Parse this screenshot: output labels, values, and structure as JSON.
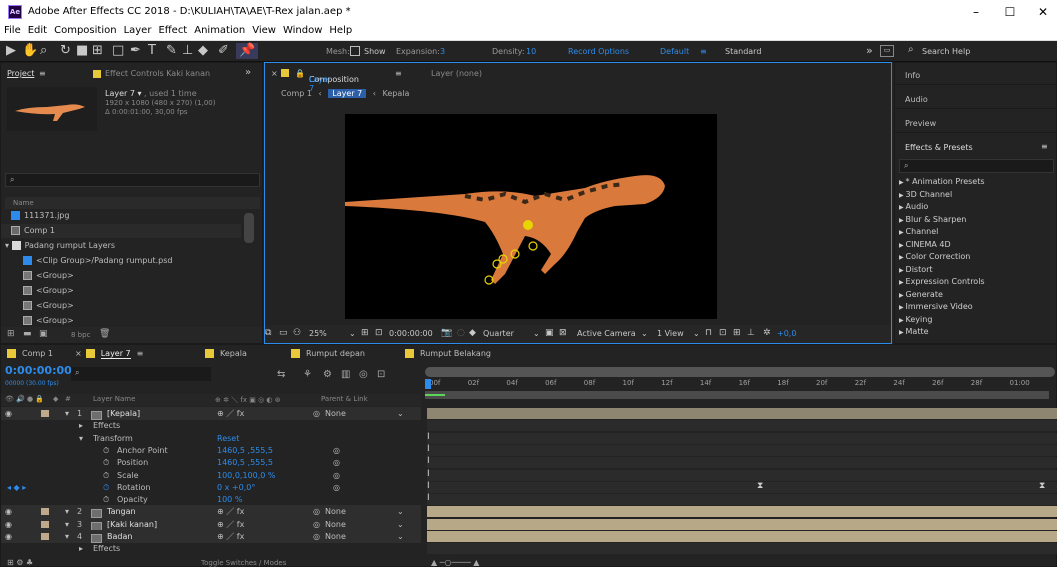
{
  "window": {
    "title": "Adobe After Effects CC 2018 - D:\\KULIAH\\TA\\AE\\T-Rex jalan.aep *",
    "app_badge": "Ae",
    "minimize": "–",
    "maximize": "☐",
    "close": "✕"
  },
  "menu": [
    "File",
    "Edit",
    "Composition",
    "Layer",
    "Effect",
    "Animation",
    "View",
    "Window",
    "Help"
  ],
  "toolbar": {
    "mesh_label": "Mesh:",
    "show_label": "Show",
    "expansion_label": "Expansion:",
    "expansion_value": "3",
    "density_label": "Density:",
    "density_value": "10",
    "record_options": "Record Options",
    "workspace_default": "Default",
    "workspace_menu": "≡",
    "workspace_standard": "Standard",
    "more": "»",
    "search_placeholder": "Search Help"
  },
  "project": {
    "tab": "Project",
    "tab_menu": "≡",
    "effect_controls": "Effect Controls Kaki kanan",
    "more": "»",
    "layer_name": "Layer 7",
    "used": ", used 1 time",
    "res": "1920 x 1080  (480 x 270) (1,00)",
    "dur": "Δ 0:00:01:00, 30,00 fps",
    "search_icon": "⌕",
    "col_name": "Name",
    "items": [
      {
        "label": "111371.jpg",
        "type": "jpg"
      },
      {
        "label": "Comp 1",
        "type": "comp"
      },
      {
        "label": "Padang rumput Layers",
        "type": "folder"
      },
      {
        "label": "<Clip Group>/Padang rumput.psd",
        "type": "psd"
      },
      {
        "label": "<Group>",
        "type": "grp"
      },
      {
        "label": "<Group>",
        "type": "grp"
      },
      {
        "label": "<Group>",
        "type": "grp"
      },
      {
        "label": "<Group>",
        "type": "grp"
      }
    ],
    "bpc": "8 bpc"
  },
  "comp": {
    "tab": "Composition",
    "tab_comp": "Layer 7",
    "tab_menu": "≡",
    "layer_none": "Layer (none)",
    "breadcrumb": [
      "Comp 1",
      "Layer 7",
      "Kepala"
    ],
    "zoom": "25%",
    "timecode": "0:00:00:00",
    "resolution": "Quarter",
    "camera": "Active Camera",
    "views": "1 View",
    "exposure": "+0,0"
  },
  "right": {
    "info": "Info",
    "audio": "Audio",
    "preview": "Preview",
    "effects": "Effects & Presets",
    "effects_menu": "≡",
    "items": [
      "* Animation Presets",
      "3D Channel",
      "Audio",
      "Blur & Sharpen",
      "Channel",
      "CINEMA 4D",
      "Color Correction",
      "Distort",
      "Expression Controls",
      "Generate",
      "Immersive Video",
      "Keying",
      "Matte"
    ]
  },
  "timeline": {
    "tabs": [
      {
        "label": "Comp 1",
        "color": "#e8c93a"
      },
      {
        "label": "Layer 7",
        "color": "#e8c93a"
      },
      {
        "label": "Kepala",
        "color": "#e8c93a"
      },
      {
        "label": "Rumput depan",
        "color": "#e8c93a"
      },
      {
        "label": "Rumput Belakang",
        "color": "#e8c93a"
      }
    ],
    "tab_menu": "≡",
    "tab_close": "×",
    "timecode": "0:00:00:00",
    "fps": "00000 (30.00 fps)",
    "col_layer": "Layer Name",
    "col_parent": "Parent & Link",
    "num_label": "#",
    "toggle": "Toggle Switches / Modes",
    "ticks": [
      "00f",
      "02f",
      "04f",
      "06f",
      "08f",
      "10f",
      "12f",
      "14f",
      "16f",
      "18f",
      "20f",
      "22f",
      "24f",
      "26f",
      "28f",
      "01:00"
    ],
    "layers": [
      {
        "num": "1",
        "name": "[Kepala]",
        "parent": "None",
        "kind": "layer"
      },
      {
        "name": "Effects",
        "kind": "group"
      },
      {
        "name": "Transform",
        "kind": "group",
        "value": "Reset"
      },
      {
        "name": "Anchor Point",
        "kind": "prop",
        "value": "1460,5 ,555,5"
      },
      {
        "name": "Position",
        "kind": "prop",
        "value": "1460,5 ,555,5"
      },
      {
        "name": "Scale",
        "kind": "prop",
        "value": "100,0,100,0 %"
      },
      {
        "name": "Rotation",
        "kind": "prop",
        "value": "0 x +0,0°"
      },
      {
        "name": "Opacity",
        "kind": "prop",
        "value": "100 %"
      },
      {
        "num": "2",
        "name": "Tangan",
        "parent": "None",
        "kind": "layer"
      },
      {
        "num": "3",
        "name": "[Kaki kanan]",
        "parent": "None",
        "kind": "layer"
      },
      {
        "num": "4",
        "name": "Badan",
        "parent": "None",
        "kind": "layer"
      },
      {
        "name": "Effects",
        "kind": "group"
      }
    ]
  }
}
